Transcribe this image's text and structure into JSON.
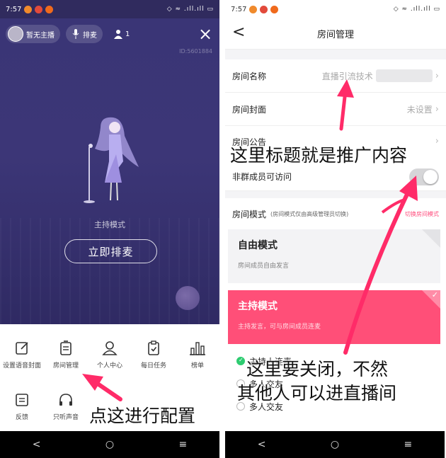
{
  "left_phone": {
    "status": {
      "time": "7:57",
      "right": "◇ ≈ .ıll.ıll ▭"
    },
    "topbar": {
      "host_label": "暂无主播",
      "queue_label": "排麦",
      "online_count": "1",
      "close_icon": "×"
    },
    "room_id": "ID:5601884",
    "mode_text": "主持模式",
    "queue_button": "立即排麦",
    "menu": [
      {
        "label": "设置语音封面",
        "icon": "edit-icon"
      },
      {
        "label": "房间管理",
        "icon": "list-icon"
      },
      {
        "label": "个人中心",
        "icon": "person-icon"
      },
      {
        "label": "每日任务",
        "icon": "clipboard-icon"
      },
      {
        "label": "榜单",
        "icon": "bar-chart-icon"
      },
      {
        "label": "反馈",
        "icon": "feedback-icon"
      },
      {
        "label": "只听声音",
        "icon": "headphones-icon"
      }
    ],
    "nav": {
      "back": "<",
      "home": "○",
      "menu": "≡"
    }
  },
  "right_phone": {
    "status": {
      "time": "7:57",
      "right": "◇ ≈ .ıll.ıll ▭"
    },
    "header": {
      "back": "<",
      "title": "房间管理"
    },
    "rows": {
      "name_label": "房间名称",
      "name_value": "直播引流技术",
      "cover_label": "房间封面",
      "cover_value": "未设置",
      "notice_label": "房间公告",
      "non_member_label": "非群成员可访问"
    },
    "mode_section": {
      "label": "房间模式",
      "hint": "(房间模式仅由高级管理员切换)",
      "switch": "切换房间模式"
    },
    "cards": {
      "free_title": "自由模式",
      "free_desc": "房间成员自由发言",
      "host_title": "主持模式",
      "host_desc": "主持发言，可与房间成员连麦"
    },
    "options": [
      "主持人连麦",
      "多人交友",
      "多人交友"
    ],
    "nav": {
      "back": "<",
      "home": "○",
      "menu": "≡"
    }
  },
  "annotations": {
    "title_note": "这里标题就是推广内容",
    "close_note_1": "这里要关闭，不然",
    "close_note_2": "其他人可以进直播间",
    "config_note": "点这进行配置"
  },
  "colors": {
    "stage_purple": "#3a3576",
    "accent_pink": "#ff4f78",
    "arrow_pink": "#ff2b68",
    "toggle_off": "#d6d6d8",
    "radio_on": "#2ecc71"
  }
}
